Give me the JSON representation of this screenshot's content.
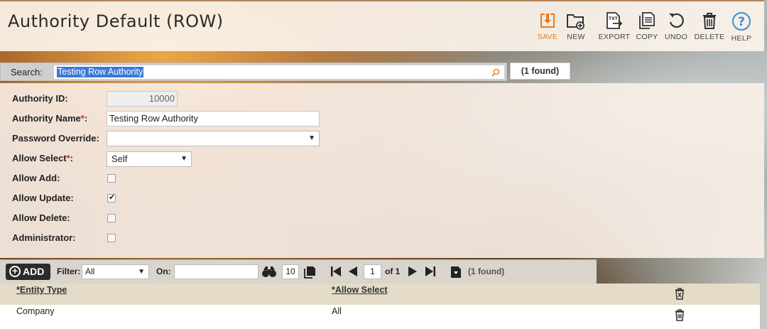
{
  "header": {
    "title": "Authority Default (ROW)",
    "toolbar": {
      "save": "SAVE",
      "new": "NEW",
      "export": "EXPORT",
      "export_badge": "TXT",
      "copy": "COPY",
      "undo": "UNDO",
      "delete": "DELETE",
      "help": "HELP"
    },
    "accent_color": "#e87b1e"
  },
  "search": {
    "label": "Search:",
    "value": "Testing Row Authority",
    "found": "(1 found)"
  },
  "form": {
    "authority_id": {
      "label": "Authority ID:",
      "value": "10000"
    },
    "authority_name": {
      "label": "Authority Name",
      "required": "*",
      "colon": ":",
      "value": "Testing Row Authority"
    },
    "password_override": {
      "label": "Password Override:",
      "value": ""
    },
    "allow_select": {
      "label": "Allow Select",
      "required": "*",
      "colon": ":",
      "value": "Self"
    },
    "allow_add": {
      "label": "Allow Add:",
      "checked": false
    },
    "allow_update": {
      "label": "Allow Update:",
      "checked": true
    },
    "allow_delete": {
      "label": "Allow Delete:",
      "checked": false
    },
    "administrator": {
      "label": "Administrator:",
      "checked": false
    }
  },
  "grid_toolbar": {
    "add_label": "ADD",
    "filter_label": "Filter:",
    "filter_value": "All",
    "on_label": "On:",
    "on_value": "",
    "page_size": "10",
    "current_page": "1",
    "of_pages": "of 1",
    "found": "(1 found)"
  },
  "grid": {
    "columns": [
      "*Entity Type",
      "*Allow Select"
    ],
    "rows": [
      {
        "entity_type": "Company",
        "allow_select": "All"
      }
    ]
  },
  "icons": {
    "save": "save-icon",
    "new": "new-folder-icon",
    "export": "export-icon",
    "copy": "copy-icon",
    "undo": "undo-icon",
    "delete": "trash-icon",
    "help": "help-icon"
  }
}
